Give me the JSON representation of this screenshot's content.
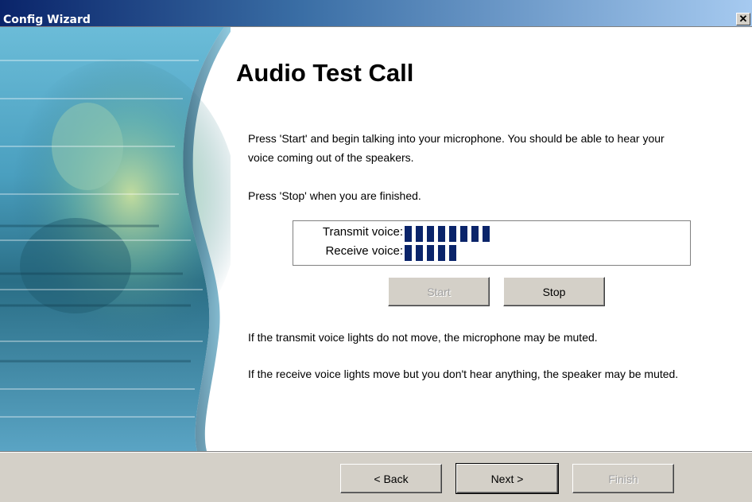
{
  "window": {
    "title": "Config Wizard",
    "close_glyph": "✕"
  },
  "page": {
    "heading": "Audio Test Call",
    "instructions_1": "Press 'Start' and begin talking into your microphone. You should be able to hear your voice coming out of the speakers.",
    "instructions_2": "Press 'Stop' when you are finished.",
    "hint_transmit": "If the transmit voice lights do not move, the microphone may be muted.",
    "hint_receive": "If the receive voice lights move but you don't hear anything, the speaker may be muted."
  },
  "meters": {
    "transmit": {
      "label": "Transmit voice:",
      "lit_segments": 8
    },
    "receive": {
      "label": "Receive voice:",
      "lit_segments": 5
    }
  },
  "test_buttons": {
    "start": "Start",
    "start_enabled": false,
    "stop": "Stop"
  },
  "nav_buttons": {
    "back": "< Back",
    "next": "Next >",
    "finish": "Finish",
    "finish_enabled": false
  },
  "colors": {
    "meter_segment": "#0a246a",
    "title_bar_start": "#0a246a",
    "title_bar_end": "#a6caf0"
  }
}
